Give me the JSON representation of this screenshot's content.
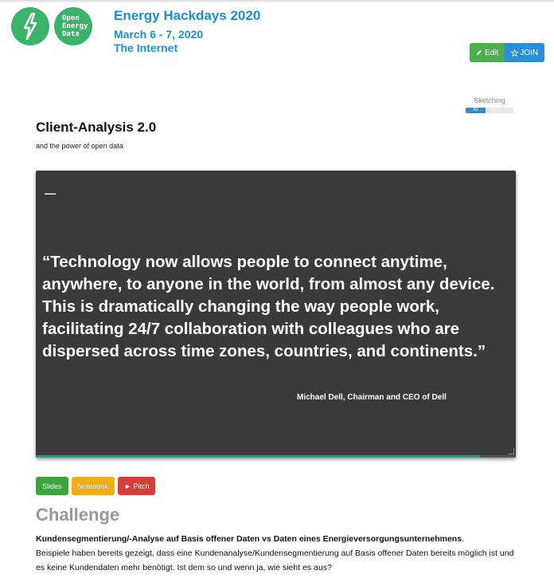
{
  "logos": {
    "bolt_icon": "lightning-bolt-icon",
    "oed_lines": [
      "Open",
      "Energy",
      "Data"
    ],
    "color": "#3bb36b"
  },
  "event": {
    "title": "Energy Hackdays 2020",
    "dates": "March 6 - 7, 2020",
    "location": "The Internet"
  },
  "actions": {
    "edit_label": "Edit",
    "edit_icon": "pencil-icon",
    "join_label": "JOIN",
    "join_icon": "star-outline-icon"
  },
  "stage": {
    "label": "Sketching",
    "value_text": "42",
    "progress_fraction": 0.42
  },
  "project": {
    "title": "Client-Analysis 2.0",
    "subtitle": "and the power of open data"
  },
  "slide": {
    "dash": "—",
    "quote": "“Technology now allows people to connect anytime, anywhere, to anyone in the world, from almost any device. This is dramatically changing the way people work, facilitating 24/7 collaboration with colleagues who are dispersed across time zones, countries, and continents.”",
    "attribution": "Michael Dell, Chairman and CEO of Dell",
    "progress_fraction": 0.926
  },
  "links": {
    "slides": "Slides",
    "notebook": "Notebook",
    "pitch": "► Pitch"
  },
  "challenge": {
    "heading": "Challenge",
    "bold_text": "Kundensegmentierung/-Analyse auf Basis offener Daten vs Daten eines Energieversorgungsunternehmens",
    "trail": ".",
    "body": "Beispiele haben bereits gezeigt, dass eine Kundenanalyse/Kundensegmentierung auf Basis offener Daten bereits möglich ist und es keine Kundendaten mehr benötigt. Ist dem so und wenn ja, wie sieht es aus?"
  }
}
